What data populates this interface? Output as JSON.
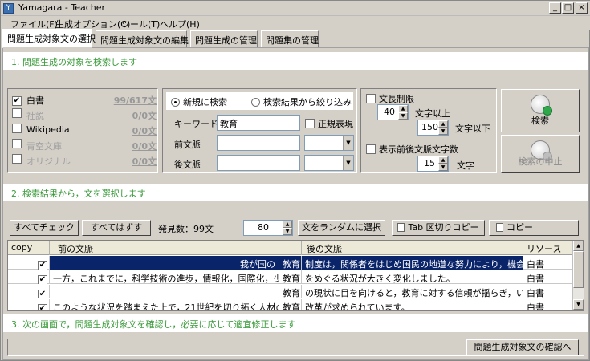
{
  "window": {
    "title": "Yamagara - Teacher"
  },
  "menu": [
    "ファイル(F)",
    "生成オプション(C)",
    "ツール(T)",
    "ヘルプ(H)"
  ],
  "tabs": [
    "問題生成対象文の選択",
    "問題生成対象文の編集",
    "問題生成の管理",
    "問題集の管理"
  ],
  "steps": {
    "step1": "1. 問題生成の対象を検索します",
    "step2": "2. 検索結果から，文を選択します",
    "step3": "3. 次の画面で，問題生成対象文を確認し，必要に応じて適宜修正します"
  },
  "sources": [
    {
      "label": "白書",
      "count": "99/617文",
      "checked": true,
      "enabled": true
    },
    {
      "label": "社説",
      "count": "0/0文",
      "checked": false,
      "enabled": false
    },
    {
      "label": "Wikipedia",
      "count": "0/0文",
      "checked": false,
      "enabled": true
    },
    {
      "label": "青空文庫",
      "count": "0/0文",
      "checked": false,
      "enabled": false
    },
    {
      "label": "オリジナル",
      "count": "0/0文",
      "checked": false,
      "enabled": false
    }
  ],
  "search": {
    "mode_new": "新規に検索",
    "mode_refine": "検索結果から絞り込み",
    "keyword_label": "キーワード",
    "keyword_value": "教育",
    "regex_label": "正規表現",
    "prev_label": "前文脈",
    "next_label": "後文脈"
  },
  "limits": {
    "length_label": "文長制限",
    "min_value": "40",
    "min_suffix": "文字以上",
    "max_value": "150",
    "max_suffix": "文字以下",
    "context_label": "表示前後文脈文字数",
    "context_value": "15",
    "context_suffix": "文字"
  },
  "actions": {
    "search": "検索",
    "stop": "検索の中止"
  },
  "toolbar": {
    "check_all": "すべてチェック",
    "uncheck_all": "すべてはずす",
    "found_label": "発見数：99文",
    "random_count": "80",
    "random_select": "文をランダムに選択",
    "tab_copy": "Tab 区切りコピー",
    "copy": "コピー"
  },
  "table": {
    "headers": [
      "copy",
      "",
      "前の文脈",
      "",
      "後の文脈",
      "リソース"
    ],
    "rows": [
      {
        "prev": "我が国の",
        "kw": "教育",
        "next": "制度は，関係者をはじめ国民の地道な努力により，機会均...",
        "res": "白書",
        "selected": true
      },
      {
        "prev": "一方，これまでに，科学技術の進歩，情報化，国際化，少...",
        "kw": "教育",
        "next": "をめぐる状況が大きく変化しました。",
        "res": "白書",
        "selected": false
      },
      {
        "prev": "",
        "kw": "教育",
        "next": "の現状に目を向けると，教育に対する信頼が揺らぎ，いく...",
        "res": "白書",
        "selected": false
      },
      {
        "prev": "このような状況を踏まえた上で，21世紀を切り拓く人材の...",
        "kw": "教育",
        "next": "改革が求められています。",
        "res": "白書",
        "selected": false
      }
    ]
  },
  "next_button": "問題生成対象文の確認へ",
  "colors": {
    "selection": "#0a246a",
    "step_text": "#3a9a3a",
    "face": "#d4d0c8"
  }
}
